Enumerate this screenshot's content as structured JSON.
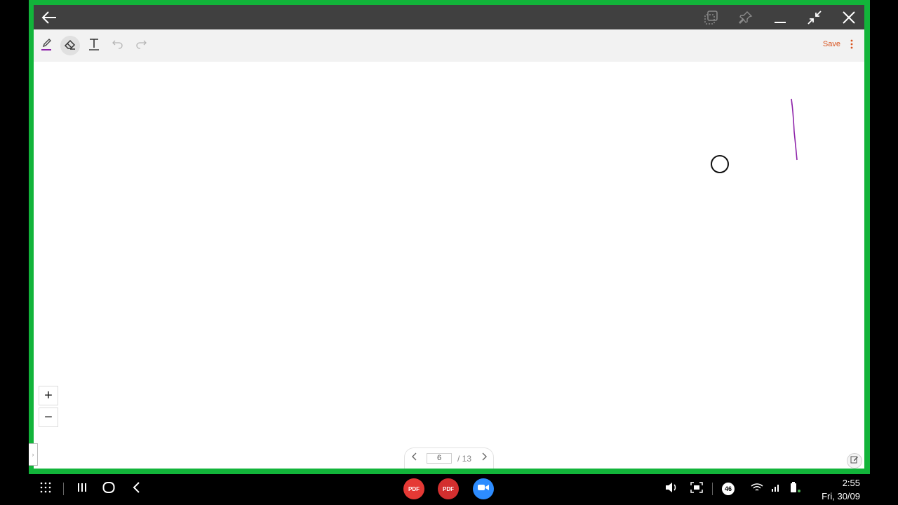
{
  "titlebar": {
    "back_icon": "arrow-left-icon",
    "window_icons": [
      "multi-window-icon",
      "pin-icon",
      "minimize-icon",
      "shrink-icon",
      "close-icon"
    ]
  },
  "toolbar": {
    "tools": [
      "pen-icon",
      "eraser-icon",
      "text-icon",
      "undo-icon",
      "redo-icon"
    ],
    "pen_color": "#8e24aa",
    "save_label": "Save",
    "more_icon": "more-vertical-icon"
  },
  "zoom": {
    "in_label": "+",
    "out_label": "−"
  },
  "pager": {
    "current_page": "6",
    "total_label": "/ 13"
  },
  "taskbar": {
    "apps": [
      {
        "name": "pdf-editor",
        "label": "PDF",
        "color": "#e53935"
      },
      {
        "name": "pdf-reader",
        "label": "PDF",
        "color": "#d32f2f"
      },
      {
        "name": "video-meeting",
        "label": "",
        "color": "#2d8cff"
      }
    ],
    "status_badge": "46",
    "time": "2:55",
    "date": "Fri, 30/09"
  },
  "colors": {
    "frame_green": "#12b43a",
    "titlebar": "#404040",
    "accent_save": "#d9531e"
  }
}
